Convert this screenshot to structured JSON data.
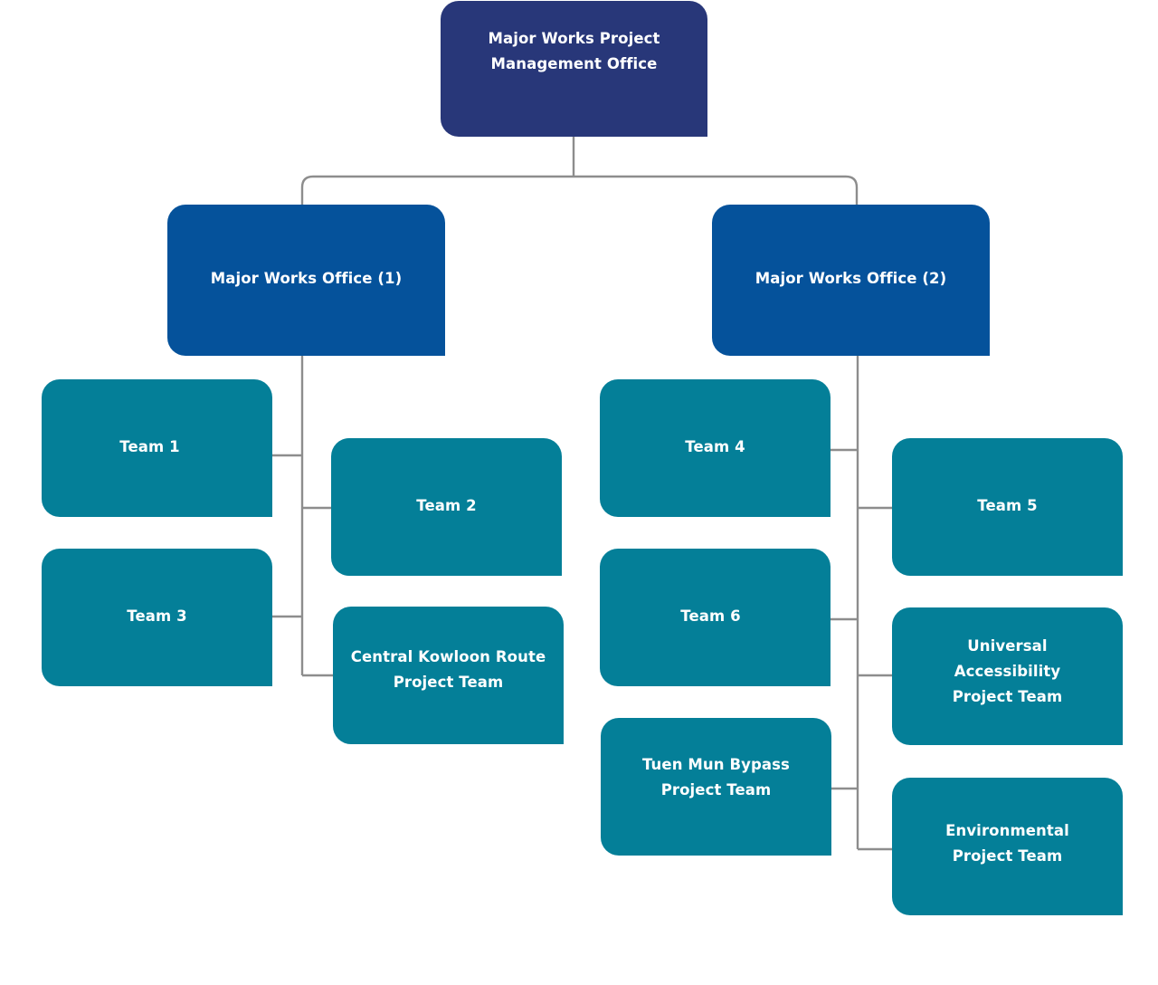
{
  "diagram": {
    "type": "org-chart",
    "root": {
      "label": "Major Works Project\nManagement Office",
      "color": "#283779"
    },
    "offices": [
      {
        "label": "Major Works Office (1)",
        "color": "#05529b",
        "teams": [
          "Team 1",
          "Team 2",
          "Team 3",
          "Central Kowloon Route\nProject Team"
        ]
      },
      {
        "label": "Major Works Office (2)",
        "color": "#05529b",
        "teams": [
          "Team 4",
          "Team 5",
          "Team 6",
          "Universal\nAccessibility\nProject Team",
          "Tuen Mun Bypass\nProject Team",
          "Environmental\nProject Team"
        ]
      }
    ],
    "team_color": "#047f98",
    "connector_color": "#8d8d8d"
  }
}
